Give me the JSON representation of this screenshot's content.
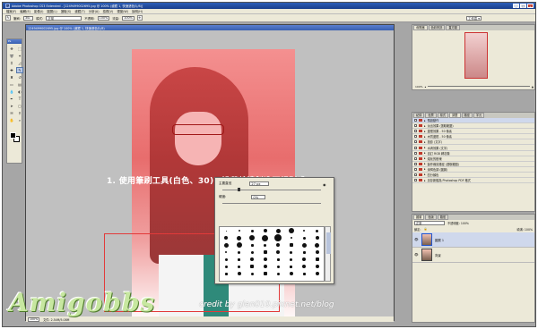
{
  "window": {
    "title": "Adobe Photoshop CS3 Extended - [1249499002695.jpg @ 100% (濾鏡 1, 快速遮色片/8)]",
    "app_logo": "Ps",
    "buttons": [
      "_",
      "□",
      "×"
    ]
  },
  "menu": [
    "檔案(F)",
    "編輯(E)",
    "影像(I)",
    "圖層(L)",
    "選取(S)",
    "濾鏡(T)",
    "分析(A)",
    "檢視(V)",
    "視窗(W)",
    "說明(H)"
  ],
  "options": {
    "brush_label": "筆刷:",
    "brush_size": "30",
    "mode_label": "模式:",
    "mode_value": "正常",
    "opacity_label": "不透明:",
    "opacity_value": "100%",
    "flow_label": "流量:",
    "flow_value": "100%",
    "workspace_label": "工作區 ▾"
  },
  "toolbox": {
    "title": "Ps"
  },
  "document": {
    "title": "1249499002695.jpg @ 100% (濾鏡 1, 快速遮色片/8)",
    "zoom": "100%",
    "status": "文件: 2.54M/5.08M"
  },
  "instruction": "1. 使用筆刷工具(白色、30)，沿著線邊製造不規則感。",
  "brush_popup": {
    "diameter_label": "主要直徑",
    "diameter_value": "27 px",
    "hardness_label": "硬度:",
    "hardness_value": "0%"
  },
  "navigator": {
    "tabs": [
      "導覽器",
      "色彩資訊",
      "直方圖"
    ],
    "zoom": "100%"
  },
  "history": {
    "tabs": [
      "紀錄",
      "色票",
      "樣式",
      "調整",
      "路徑",
      "字元"
    ],
    "rows": [
      "預設動作",
      "淡出效果 (選取範圍)",
      "邊框效果 - 50 像素",
      "木質邊框 - 50 像素",
      "投影 (文字)",
      "水滴效果 (文字)",
      "自訂 RGB 轉灰階",
      "熔化的鉛塊",
      "製作裁剪路徑 (選取範圍)",
      "深褐色調 (圖層)",
      "四分顏色",
      "另存新檔為 Photoshop PDF 格式"
    ]
  },
  "layers": {
    "tabs": [
      "圖層",
      "色版",
      "路徑"
    ],
    "mode": "正常",
    "opacity_label": "不透明度: 100%",
    "lock_label": "鎖定:",
    "fill_label": "填滿: 100%",
    "rows": [
      {
        "name": "圖層 1",
        "selected": true
      },
      {
        "name": "背景",
        "selected": false
      }
    ]
  },
  "watermark": "Amigobbs",
  "credit": "credit by glen010.pixnet.net/blog",
  "colors": {
    "accent": "#e23a3a",
    "titlebar": "#2d5fb8"
  }
}
